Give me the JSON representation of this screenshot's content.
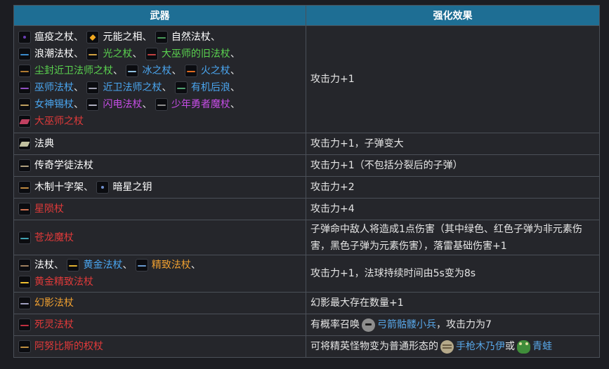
{
  "table": {
    "headers": [
      "武器",
      "强化效果"
    ],
    "rows": [
      {
        "weapons": [
          {
            "name": "瘟疫之杖",
            "color": "#ffffff",
            "icon": "plague-staff-icon"
          },
          {
            "name": "元能之相",
            "color": "#ffffff",
            "icon": "aether-lens-icon"
          },
          {
            "name": "自然法杖",
            "color": "#ffffff",
            "icon": "nature-staff-icon"
          },
          {
            "name": "浪潮法杖",
            "color": "#ffffff",
            "icon": "tide-staff-icon"
          },
          {
            "name": "光之杖",
            "color": "#5ad24f",
            "icon": "light-staff-icon"
          },
          {
            "name": "大巫师的旧法杖",
            "color": "#5ad24f",
            "icon": "archmage-old-staff-icon"
          },
          {
            "name": "尘封近卫法师之杖",
            "color": "#5ad24f",
            "icon": "dusty-guard-mage-staff-icon"
          },
          {
            "name": "冰之杖",
            "color": "#4aa6f0",
            "icon": "ice-staff-icon"
          },
          {
            "name": "火之杖",
            "color": "#4aa6f0",
            "icon": "fire-staff-icon"
          },
          {
            "name": "巫师法杖",
            "color": "#4aa6f0",
            "icon": "wizard-staff-icon"
          },
          {
            "name": "近卫法师之杖",
            "color": "#4aa6f0",
            "icon": "guard-mage-staff-icon"
          },
          {
            "name": "有机后浪",
            "color": "#4aa6f0",
            "icon": "organic-wave-icon"
          },
          {
            "name": "女神锡杖",
            "color": "#4aa6f0",
            "icon": "goddess-scepter-icon"
          },
          {
            "name": "闪电法杖",
            "color": "#c64de6",
            "icon": "lightning-staff-icon"
          },
          {
            "name": "少年勇者魔杖",
            "color": "#c64de6",
            "icon": "young-hero-wand-icon"
          },
          {
            "name": "大巫师之杖",
            "color": "#e03a3a",
            "icon": "archmage-staff-icon"
          }
        ],
        "effect": "攻击力+1"
      },
      {
        "weapons": [
          {
            "name": "法典",
            "color": "#ffffff",
            "icon": "codex-icon"
          }
        ],
        "effect": "攻击力+1，子弹变大"
      },
      {
        "weapons": [
          {
            "name": "传奇学徒法杖",
            "color": "#ffffff",
            "icon": "legendary-apprentice-staff-icon"
          }
        ],
        "effect": "攻击力+1（不包括分裂后的子弹）"
      },
      {
        "weapons": [
          {
            "name": "木制十字架",
            "color": "#ffffff",
            "icon": "wooden-cross-icon"
          },
          {
            "name": "暗星之钥",
            "color": "#ffffff",
            "icon": "dark-star-key-icon"
          }
        ],
        "effect": "攻击力+2"
      },
      {
        "weapons": [
          {
            "name": "星陨杖",
            "color": "#e03a3a",
            "icon": "meteor-staff-icon"
          }
        ],
        "effect": "攻击力+4"
      },
      {
        "weapons": [
          {
            "name": "苍龙魔杖",
            "color": "#e03a3a",
            "icon": "azure-dragon-wand-icon"
          }
        ],
        "effect": "子弹命中敌人将造成1点伤害（其中绿色、红色子弹为非元素伤害，黑色子弹为元素伤害），落雷基础伤害+1"
      },
      {
        "weapons": [
          {
            "name": "法杖",
            "color": "#ffffff",
            "icon": "staff-icon"
          },
          {
            "name": "黄金法杖",
            "color": "#4aa6f0",
            "icon": "golden-staff-icon"
          },
          {
            "name": "精致法杖",
            "color": "#f0a030",
            "icon": "fine-staff-icon"
          },
          {
            "name": "黄金精致法杖",
            "color": "#e03a3a",
            "icon": "golden-fine-staff-icon"
          }
        ],
        "effect": "攻击力+1，法球持续时间由5s变为8s"
      },
      {
        "weapons": [
          {
            "name": "幻影法杖",
            "color": "#f0a030",
            "icon": "phantom-staff-icon"
          }
        ],
        "effect": "幻影最大存在数量+1"
      },
      {
        "weapons": [
          {
            "name": "死灵法杖",
            "color": "#e03a3a",
            "icon": "necro-staff-icon"
          }
        ],
        "effect_parts": [
          "有概率召唤",
          "弓箭骷髅小兵",
          "，攻击力为7"
        ]
      },
      {
        "weapons": [
          {
            "name": "阿努比斯的权杖",
            "color": "#e03a3a",
            "icon": "anubis-scepter-icon"
          }
        ],
        "effect_parts": [
          "可将精英怪物变为普通形态的",
          "手枪木乃伊",
          "或",
          "青蛙"
        ]
      }
    ],
    "sep": "、"
  }
}
